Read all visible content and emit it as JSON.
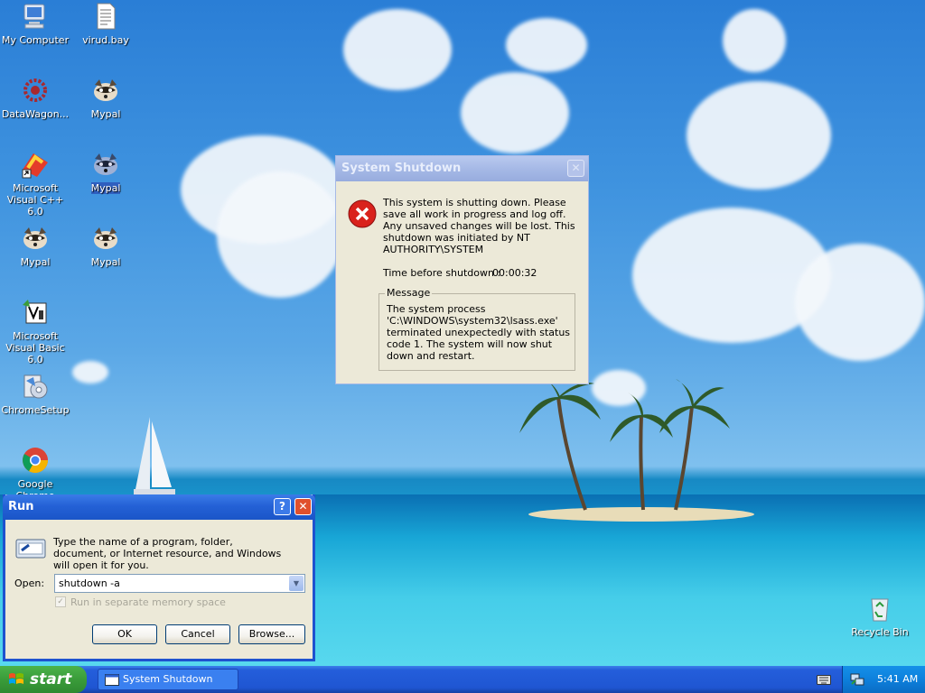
{
  "desktop": {
    "icons": [
      {
        "label": "My Computer"
      },
      {
        "label": "virud.bay"
      },
      {
        "label": "DataWagon..."
      },
      {
        "label": "Mypal"
      },
      {
        "label": "Microsoft Visual C++ 6.0"
      },
      {
        "label": "Mypal"
      },
      {
        "label": "Mypal"
      },
      {
        "label": "Mypal"
      },
      {
        "label": "Microsoft Visual Basic 6.0"
      },
      {
        "label": "ChromeSetup"
      },
      {
        "label": "Google Chrome"
      },
      {
        "label": "Recycle Bin"
      }
    ]
  },
  "shutdown_dialog": {
    "title": "System Shutdown",
    "message": "This system is shutting down. Please save all work in progress and log off. Any unsaved changes will be lost. This shutdown was initiated by NT AUTHORITY\\SYSTEM",
    "time_label": "Time before shutdown :",
    "time_value": "00:00:32",
    "group_label": "Message",
    "group_text": "The system process 'C:\\WINDOWS\\system32\\lsass.exe' terminated unexpectedly with status code 1.  The system will now shut down and restart."
  },
  "run_dialog": {
    "title": "Run",
    "description": "Type the name of a program, folder, document, or Internet resource, and Windows will open it for you.",
    "open_label": "Open:",
    "open_value": "shutdown -a",
    "checkbox_label": "Run in separate memory space",
    "ok_label": "OK",
    "cancel_label": "Cancel",
    "browse_label": "Browse..."
  },
  "taskbar": {
    "start_label": "start",
    "task_label": "System Shutdown",
    "clock": "5:41 AM"
  },
  "colors": {
    "error_red": "#d9221c",
    "title_blue": "#245edb"
  }
}
